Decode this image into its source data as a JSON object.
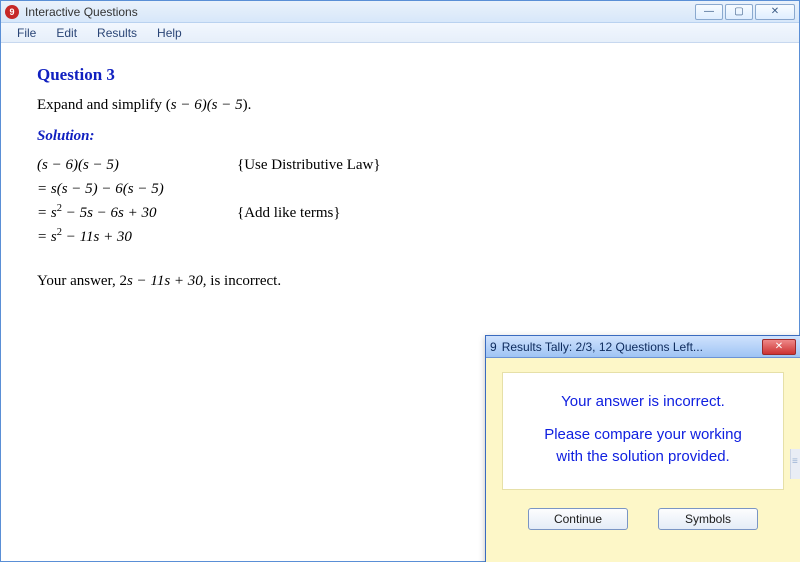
{
  "window": {
    "title": "Interactive Questions",
    "controls": {
      "minimize": "—",
      "maximize": "▢",
      "close": "✕"
    }
  },
  "menu": {
    "file": "File",
    "edit": "Edit",
    "results": "Results",
    "help": "Help"
  },
  "question": {
    "title": "Question 3",
    "prompt_pre": "Expand and simplify (",
    "prompt_expr": "s − 6)(s − 5",
    "prompt_post": ").",
    "solution_label": "Solution:",
    "rows": [
      {
        "eq": "",
        "expr_html": "   (s − 6)(s − 5)",
        "note": "{Use Distributive Law}"
      },
      {
        "eq": "=",
        "expr_html": " s(s − 5) − 6(s − 5)",
        "note": ""
      },
      {
        "eq": "=",
        "expr_html": " s<sup>2</sup> − 5s − 6s + 30",
        "note": "{Add like terms}"
      },
      {
        "eq": "=",
        "expr_html": " s<sup>2</sup> − 11s + 30",
        "note": ""
      }
    ],
    "feedback_pre": "Your answer, 2",
    "feedback_expr": "s − 11s + 30",
    "feedback_post": ", is incorrect."
  },
  "tally": {
    "title": "Results Tally:  2/3, 12 Questions Left...",
    "close": "✕",
    "line1": "Your answer is incorrect.",
    "line2": "Please compare your working",
    "line3": "with the solution provided.",
    "continue": "Continue",
    "symbols": "Symbols"
  }
}
